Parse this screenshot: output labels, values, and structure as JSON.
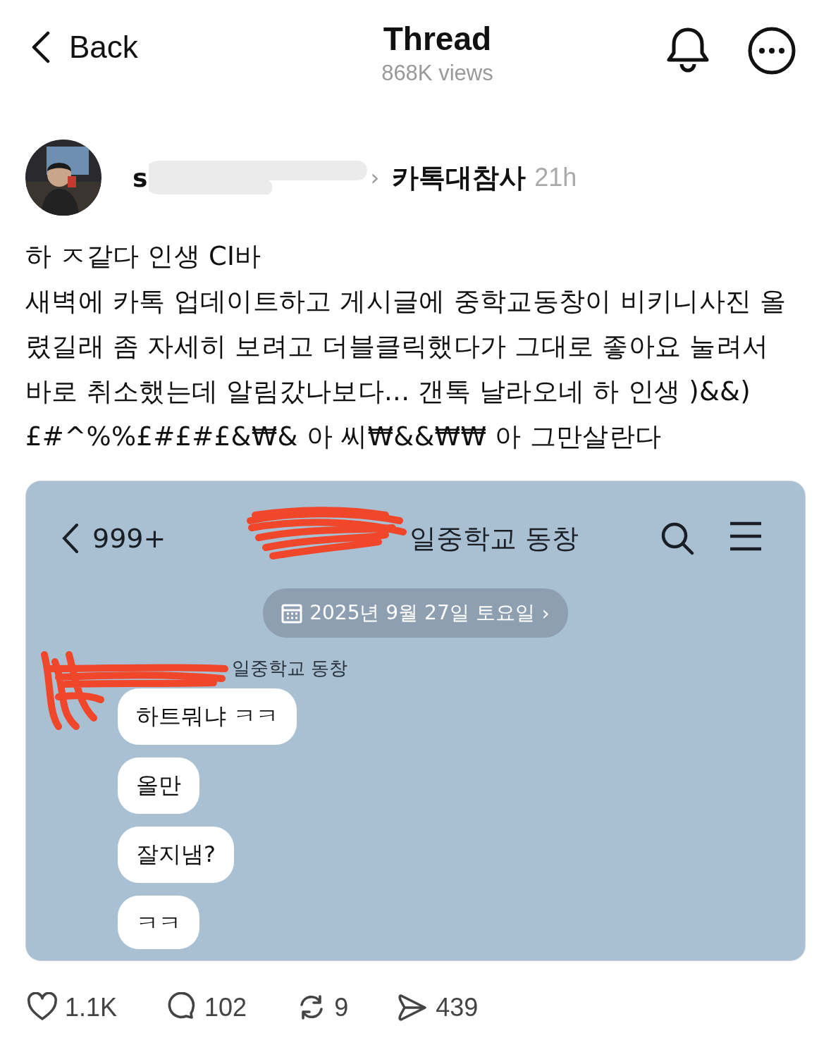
{
  "header": {
    "back": "Back",
    "title": "Thread",
    "views": "868K views"
  },
  "post": {
    "author": "s",
    "topic_arrow": "›",
    "topic": "카톡대참사",
    "time": "21h",
    "lines": [
      "하 ㅈ같다 인생 CI바",
      "새벽에 카톡 업데이트하고 게시글에 중학교동창이 비키니사진 올렸길래 좀 자세히 보려고 더블클릭했다가 그대로 좋아요 눌려서 바로 취소했는데 알림갔나보다... 갠톡 날라오네 하 인생 )&&)£#^%%£#£#£&₩& 아 씨₩&&₩₩ 아 그만살란다"
    ],
    "screenshot": {
      "unread": "999+",
      "chat_title": "일중학교 동창",
      "date": "2025년 9월 27일 토요일",
      "date_arrow": "›",
      "sender": "일중학교 동창",
      "messages": [
        "하트뭐냐 ㅋㅋ",
        "올만",
        "잘지냄?",
        "ㅋㅋ"
      ]
    }
  },
  "actions": [
    {
      "kind": "like",
      "count": "1.1K"
    },
    {
      "kind": "reply",
      "count": "102"
    },
    {
      "kind": "repost",
      "count": "9"
    },
    {
      "kind": "share",
      "count": "439"
    }
  ]
}
